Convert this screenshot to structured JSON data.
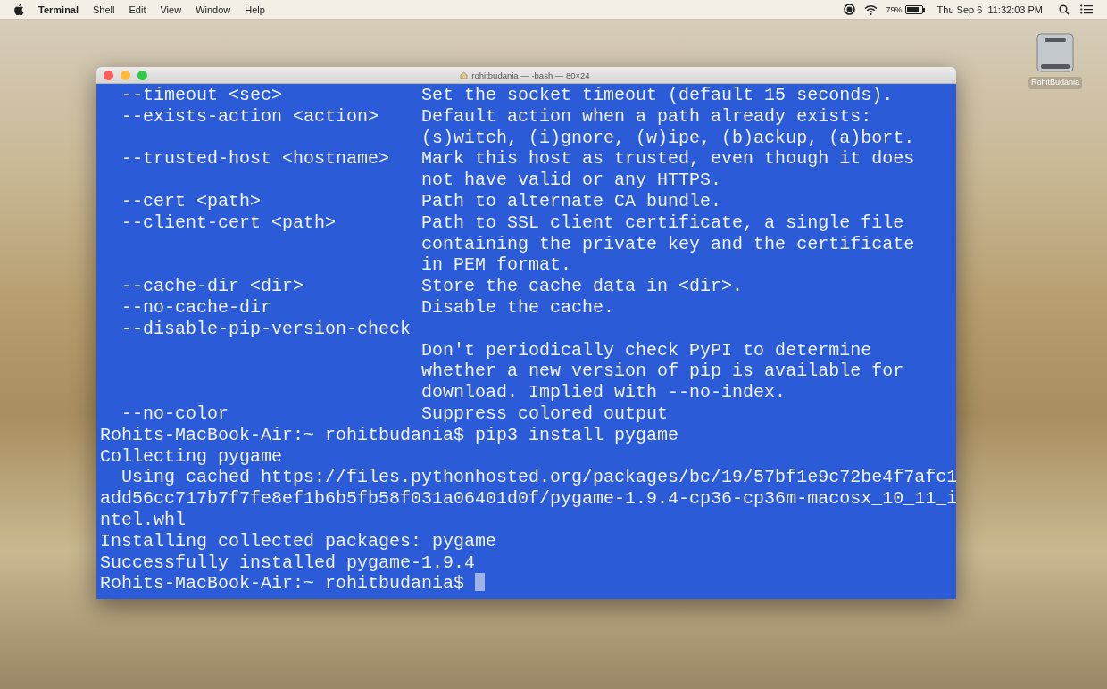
{
  "menu_bar": {
    "menus": [
      {
        "label": "Terminal",
        "app": true
      },
      {
        "label": "Shell",
        "app": false
      },
      {
        "label": "Edit",
        "app": false
      },
      {
        "label": "View",
        "app": false
      },
      {
        "label": "Window",
        "app": false
      },
      {
        "label": "Help",
        "app": false
      }
    ],
    "battery": "79%",
    "clock": "Thu Sep 6  11:32:03 PM"
  },
  "desktop_icon": {
    "label": "RohitBudania"
  },
  "terminal": {
    "title": "rohitbudania — -bash — 80×24",
    "lines": [
      "  --timeout <sec>             Set the socket timeout (default 15 seconds).",
      "  --exists-action <action>    Default action when a path already exists:",
      "                              (s)witch, (i)gnore, (w)ipe, (b)ackup, (a)bort.",
      "  --trusted-host <hostname>   Mark this host as trusted, even though it does",
      "                              not have valid or any HTTPS.",
      "  --cert <path>               Path to alternate CA bundle.",
      "  --client-cert <path>        Path to SSL client certificate, a single file",
      "                              containing the private key and the certificate",
      "                              in PEM format.",
      "  --cache-dir <dir>           Store the cache data in <dir>.",
      "  --no-cache-dir              Disable the cache.",
      "  --disable-pip-version-check",
      "                              Don't periodically check PyPI to determine",
      "                              whether a new version of pip is available for",
      "                              download. Implied with --no-index.",
      "  --no-color                  Suppress colored output",
      "Rohits-MacBook-Air:~ rohitbudania$ pip3 install pygame",
      "Collecting pygame",
      "  Using cached https://files.pythonhosted.org/packages/bc/19/57bf1e9c72be4f7afc1",
      "add56cc717b7f7fe8ef1b6b5fb58f031a06401d0f/pygame-1.9.4-cp36-cp36m-macosx_10_11_i",
      "ntel.whl",
      "Installing collected packages: pygame",
      "Successfully installed pygame-1.9.4",
      "Rohits-MacBook-Air:~ rohitbudania$ "
    ],
    "cursor": true
  }
}
